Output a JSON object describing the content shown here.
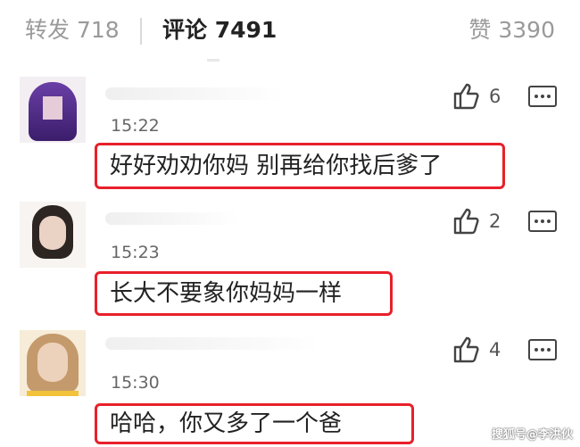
{
  "tabs": {
    "repost": "转发 718",
    "comment": "评论 7491",
    "like": "赞 3390"
  },
  "comments": [
    {
      "time": "15:22",
      "likes": "6",
      "text": "好好劝劝你妈 别再给你找后爹了"
    },
    {
      "time": "15:23",
      "likes": "2",
      "text": "长大不要象你妈妈一样"
    },
    {
      "time": "15:30",
      "likes": "4",
      "text": "哈哈，你又多了一个爸"
    }
  ],
  "watermark": "搜狐号@李洪伙",
  "colors": {
    "highlight_border": "#e8202a",
    "muted_text": "#9a9a9a"
  }
}
